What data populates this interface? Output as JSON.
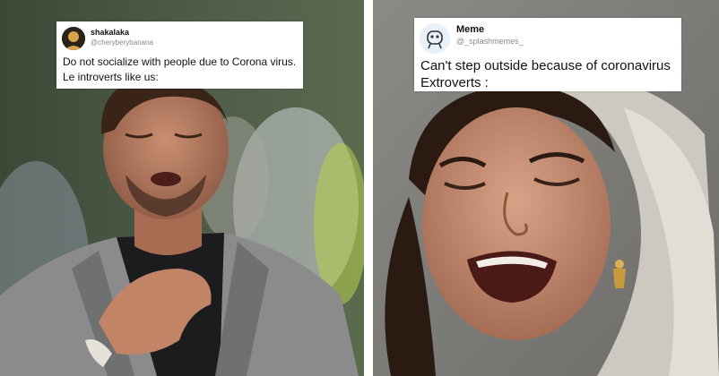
{
  "left_meme": {
    "tweet": {
      "display_name": "shakalaka",
      "handle": "@cheryberybanana",
      "lines": [
        "Do not socialize with people due to Corona virus.",
        "Le introverts like us:"
      ]
    },
    "avatar_icon": "profile-photo-icon"
  },
  "right_meme": {
    "tweet": {
      "display_name": "Meme",
      "handle": "@_splashmemes_",
      "lines": [
        "Can't step outside because of coronavirus",
        "Extroverts :"
      ]
    },
    "avatar_icon": "robot-face-icon"
  },
  "colors": {
    "tweet_background": "#ffffff",
    "tweet_text": "#111111",
    "handle_text": "#8a8a8a",
    "avatar_right_bg": "#e8f1fa"
  }
}
